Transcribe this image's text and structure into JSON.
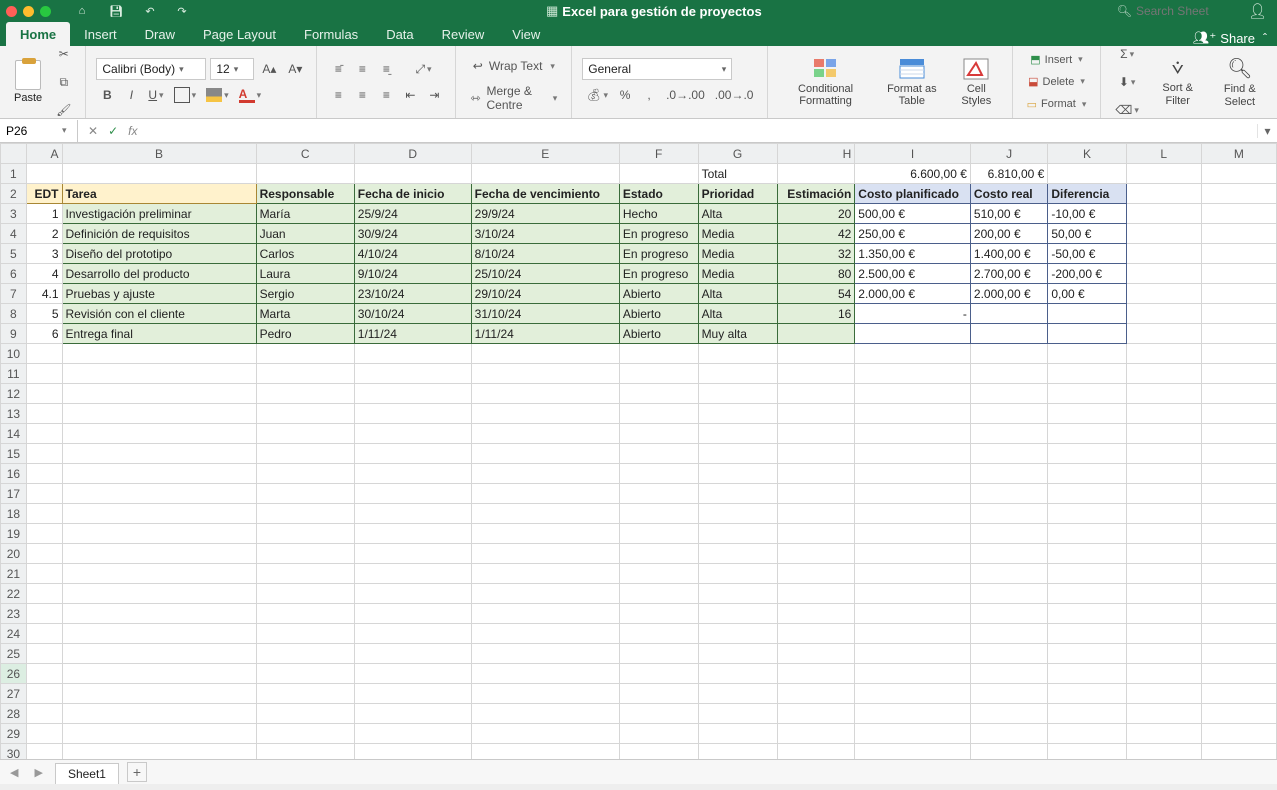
{
  "window": {
    "title": "Excel para gestión de proyectos"
  },
  "search": {
    "placeholder": "Search Sheet"
  },
  "share_label": "Share",
  "tabs": [
    "Home",
    "Insert",
    "Draw",
    "Page Layout",
    "Formulas",
    "Data",
    "Review",
    "View"
  ],
  "active_tab": "Home",
  "ribbon": {
    "paste": "Paste",
    "font_name": "Calibri (Body)",
    "font_size": "12",
    "wrap": "Wrap Text",
    "merge": "Merge & Centre",
    "number_format": "General",
    "cond_fmt": "Conditional\nFormatting",
    "fmt_table": "Format\nas Table",
    "cell_styles": "Cell\nStyles",
    "insert": "Insert",
    "delete": "Delete",
    "format": "Format",
    "sort_filter": "Sort &\nFilter",
    "find_select": "Find &\nSelect"
  },
  "namebox": "P26",
  "columns": [
    "A",
    "B",
    "C",
    "D",
    "E",
    "F",
    "G",
    "H",
    "I",
    "J",
    "K",
    "L",
    "M"
  ],
  "total_label": "Total",
  "total_planned": "6.600,00 €",
  "total_real": "6.810,00 €",
  "headers": {
    "edt": "EDT",
    "tarea": "Tarea",
    "resp": "Responsable",
    "inicio": "Fecha de inicio",
    "fin": "Fecha de vencimiento",
    "estado": "Estado",
    "prio": "Prioridad",
    "est": "Estimación",
    "cplan": "Costo planificado",
    "creal": "Costo real",
    "diff": "Diferencia"
  },
  "rows": [
    {
      "edt": "1",
      "tarea": "Investigación preliminar",
      "resp": "María",
      "inicio": "25/9/24",
      "fin": "29/9/24",
      "estado": "Hecho",
      "prio": "Alta",
      "est": "20",
      "cplan": "500,00 €",
      "creal": "510,00 €",
      "diff": "-10,00 €"
    },
    {
      "edt": "2",
      "tarea": "Definición de requisitos",
      "resp": "Juan",
      "inicio": "30/9/24",
      "fin": "3/10/24",
      "estado": "En progreso",
      "prio": "Media",
      "est": "42",
      "cplan": "250,00 €",
      "creal": "200,00 €",
      "diff": "50,00 €"
    },
    {
      "edt": "3",
      "tarea": "Diseño del prototipo",
      "resp": "Carlos",
      "inicio": "4/10/24",
      "fin": "8/10/24",
      "estado": "En progreso",
      "prio": "Media",
      "est": "32",
      "cplan": "1.350,00 €",
      "creal": "1.400,00 €",
      "diff": "-50,00 €"
    },
    {
      "edt": "4",
      "tarea": "Desarrollo del producto",
      "resp": "Laura",
      "inicio": "9/10/24",
      "fin": "25/10/24",
      "estado": "En progreso",
      "prio": "Media",
      "est": "80",
      "cplan": "2.500,00 €",
      "creal": "2.700,00 €",
      "diff": "-200,00 €"
    },
    {
      "edt": "4.1",
      "tarea": "Pruebas y ajuste",
      "resp": "Sergio",
      "inicio": "23/10/24",
      "fin": "29/10/24",
      "estado": "Abierto",
      "prio": "Alta",
      "est": "54",
      "cplan": "2.000,00 €",
      "creal": "2.000,00 €",
      "diff": "0,00 €"
    },
    {
      "edt": "5",
      "tarea": "Revisión con el cliente",
      "resp": "Marta",
      "inicio": "30/10/24",
      "fin": "31/10/24",
      "estado": "Abierto",
      "prio": "Alta",
      "est": "16",
      "cplan": "-",
      "creal": "",
      "diff": ""
    },
    {
      "edt": "6",
      "tarea": "Entrega final",
      "resp": "Pedro",
      "inicio": "1/11/24",
      "fin": "1/11/24",
      "estado": "Abierto",
      "prio": "Muy alta",
      "est": "",
      "cplan": "",
      "creal": "",
      "diff": ""
    }
  ],
  "empty_rows": [
    10,
    11,
    12,
    13,
    14,
    15,
    16,
    17,
    18,
    19,
    20,
    21,
    22,
    23,
    24,
    25,
    26,
    27,
    28,
    29,
    30
  ],
  "sheet_tab": "Sheet1"
}
